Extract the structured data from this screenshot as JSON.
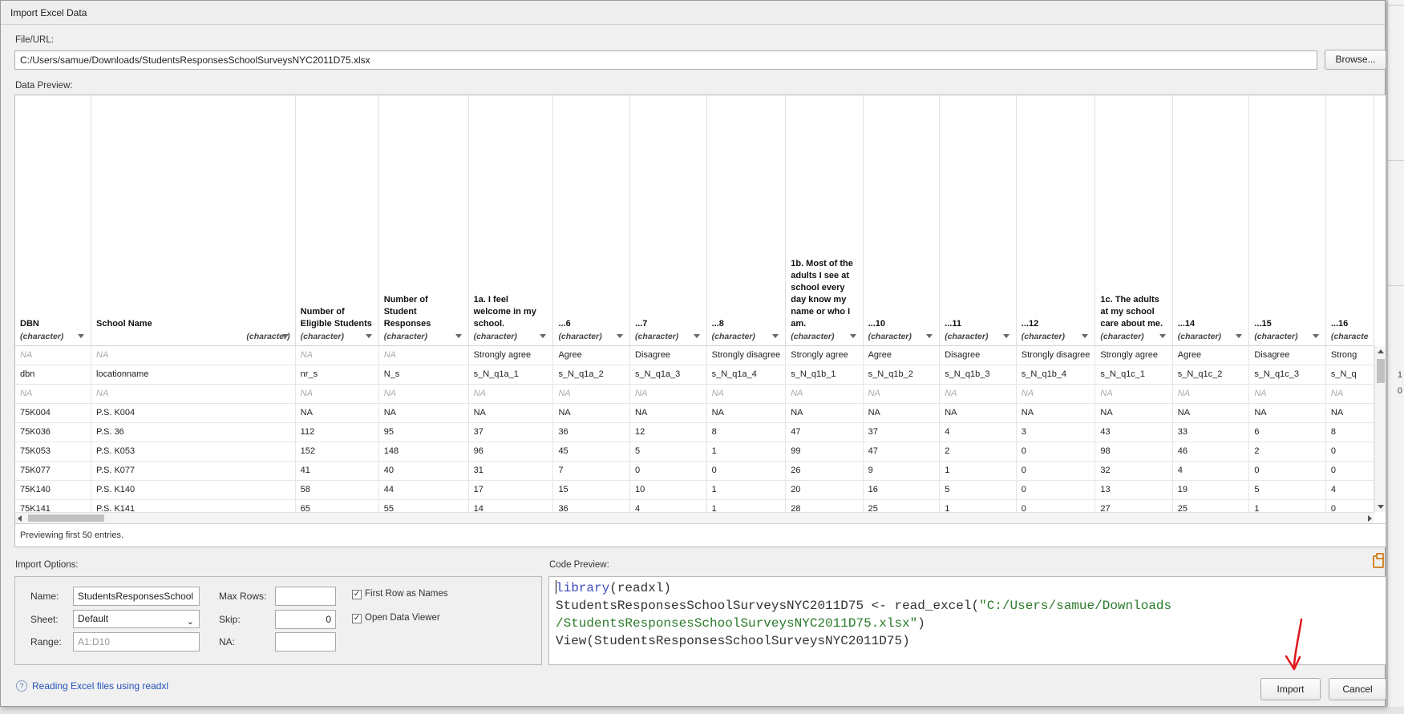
{
  "dialog": {
    "title": "Import Excel Data"
  },
  "file": {
    "label": "File/URL:",
    "value": "C:/Users/samue/Downloads/StudentsResponsesSchoolSurveysNYC2011D75.xlsx",
    "browse_label": "Browse..."
  },
  "preview": {
    "label": "Data Preview:",
    "note": "Previewing first 50 entries.",
    "columns": [
      {
        "name": "DBN",
        "type": "(character)"
      },
      {
        "name": "School Name",
        "type": "(character)"
      },
      {
        "name": "Number of Eligible Students",
        "type": "(character)"
      },
      {
        "name": "Number of Student Responses",
        "type": "(character)"
      },
      {
        "name": "1a. I feel welcome in my school.",
        "type": "(character)"
      },
      {
        "name": "...6",
        "type": "(character)"
      },
      {
        "name": "...7",
        "type": "(character)"
      },
      {
        "name": "...8",
        "type": "(character)"
      },
      {
        "name": "1b. Most of the adults I see at school every day know my name or who I am.",
        "type": "(character)"
      },
      {
        "name": "...10",
        "type": "(character)"
      },
      {
        "name": "...11",
        "type": "(character)"
      },
      {
        "name": "...12",
        "type": "(character)"
      },
      {
        "name": "1c. The adults at my school care about me.",
        "type": "(character)"
      },
      {
        "name": "...14",
        "type": "(character)"
      },
      {
        "name": "...15",
        "type": "(character)"
      },
      {
        "name": "...16",
        "type": "(characte"
      }
    ],
    "rows": [
      [
        "NA",
        "NA",
        "NA",
        "NA",
        "Strongly agree",
        "Agree",
        "Disagree",
        "Strongly disagree",
        "Strongly agree",
        "Agree",
        "Disagree",
        "Strongly disagree",
        "Strongly agree",
        "Agree",
        "Disagree",
        "Strong"
      ],
      [
        "dbn",
        "locationname",
        "nr_s",
        "N_s",
        "s_N_q1a_1",
        "s_N_q1a_2",
        "s_N_q1a_3",
        "s_N_q1a_4",
        "s_N_q1b_1",
        "s_N_q1b_2",
        "s_N_q1b_3",
        "s_N_q1b_4",
        "s_N_q1c_1",
        "s_N_q1c_2",
        "s_N_q1c_3",
        "s_N_q"
      ],
      [
        "NA",
        "NA",
        "NA",
        "NA",
        "NA",
        "NA",
        "NA",
        "NA",
        "NA",
        "NA",
        "NA",
        "NA",
        "NA",
        "NA",
        "NA",
        "NA"
      ],
      [
        "75K004",
        "P.S. K004",
        "NA",
        "NA",
        "NA",
        "NA",
        "NA",
        "NA",
        "NA",
        "NA",
        "NA",
        "NA",
        "NA",
        "NA",
        "NA",
        "NA"
      ],
      [
        "75K036",
        "P.S. 36",
        "112",
        "95",
        "37",
        "36",
        "12",
        "8",
        "47",
        "37",
        "4",
        "3",
        "43",
        "33",
        "6",
        "8"
      ],
      [
        "75K053",
        "P.S. K053",
        "152",
        "148",
        "96",
        "45",
        "5",
        "1",
        "99",
        "47",
        "2",
        "0",
        "98",
        "46",
        "2",
        "0"
      ],
      [
        "75K077",
        "P.S. K077",
        "41",
        "40",
        "31",
        "7",
        "0",
        "0",
        "26",
        "9",
        "1",
        "0",
        "32",
        "4",
        "0",
        "0"
      ],
      [
        "75K140",
        "P.S. K140",
        "58",
        "44",
        "17",
        "15",
        "10",
        "1",
        "20",
        "16",
        "5",
        "0",
        "13",
        "19",
        "5",
        "4"
      ],
      [
        "75K141",
        "P.S. K141",
        "65",
        "55",
        "14",
        "36",
        "4",
        "1",
        "28",
        "25",
        "1",
        "0",
        "27",
        "25",
        "1",
        "0"
      ]
    ],
    "na_mask": [
      [
        true,
        true,
        true,
        true,
        false,
        false,
        false,
        false,
        false,
        false,
        false,
        false,
        false,
        false,
        false,
        false
      ],
      [
        false,
        false,
        false,
        false,
        false,
        false,
        false,
        false,
        false,
        false,
        false,
        false,
        false,
        false,
        false,
        false
      ],
      [
        true,
        true,
        true,
        true,
        true,
        true,
        true,
        true,
        true,
        true,
        true,
        true,
        true,
        true,
        true,
        true
      ]
    ]
  },
  "options": {
    "label": "Import Options:",
    "name_label": "Name:",
    "name_value": "StudentsResponsesSchool",
    "sheet_label": "Sheet:",
    "sheet_value": "Default",
    "range_label": "Range:",
    "range_placeholder": "A1:D10",
    "max_rows_label": "Max Rows:",
    "max_rows_value": "",
    "skip_label": "Skip:",
    "skip_value": "0",
    "na_label": "NA:",
    "na_value": "",
    "first_row_label": "First Row as Names",
    "first_row_checked": true,
    "open_viewer_label": "Open Data Viewer",
    "open_viewer_checked": true
  },
  "code": {
    "label": "Code Preview:",
    "line1_kw": "library",
    "line1_rest": "(readxl)",
    "line2_pre": "StudentsResponsesSchoolSurveysNYC2011D75 <- read_excel(",
    "line2_str": "\"C:/Users/samue/Downloads",
    "line3_str": "/StudentsResponsesSchoolSurveysNYC2011D75.xlsx\"",
    "line3_post": ")",
    "line4": "View(StudentsResponsesSchoolSurveysNYC2011D75)"
  },
  "footer": {
    "help_icon": "?",
    "help_text": "Reading Excel files using readxl",
    "import_label": "Import",
    "cancel_label": "Cancel"
  },
  "background": {
    "frag1": "1",
    "frag2": "0"
  },
  "colors": {
    "annotation_arrow": "#e0161b",
    "link": "#2553b8",
    "keyword": "#3a4bbf",
    "string": "#2a7a2a",
    "clipboard": "#d4882a"
  }
}
